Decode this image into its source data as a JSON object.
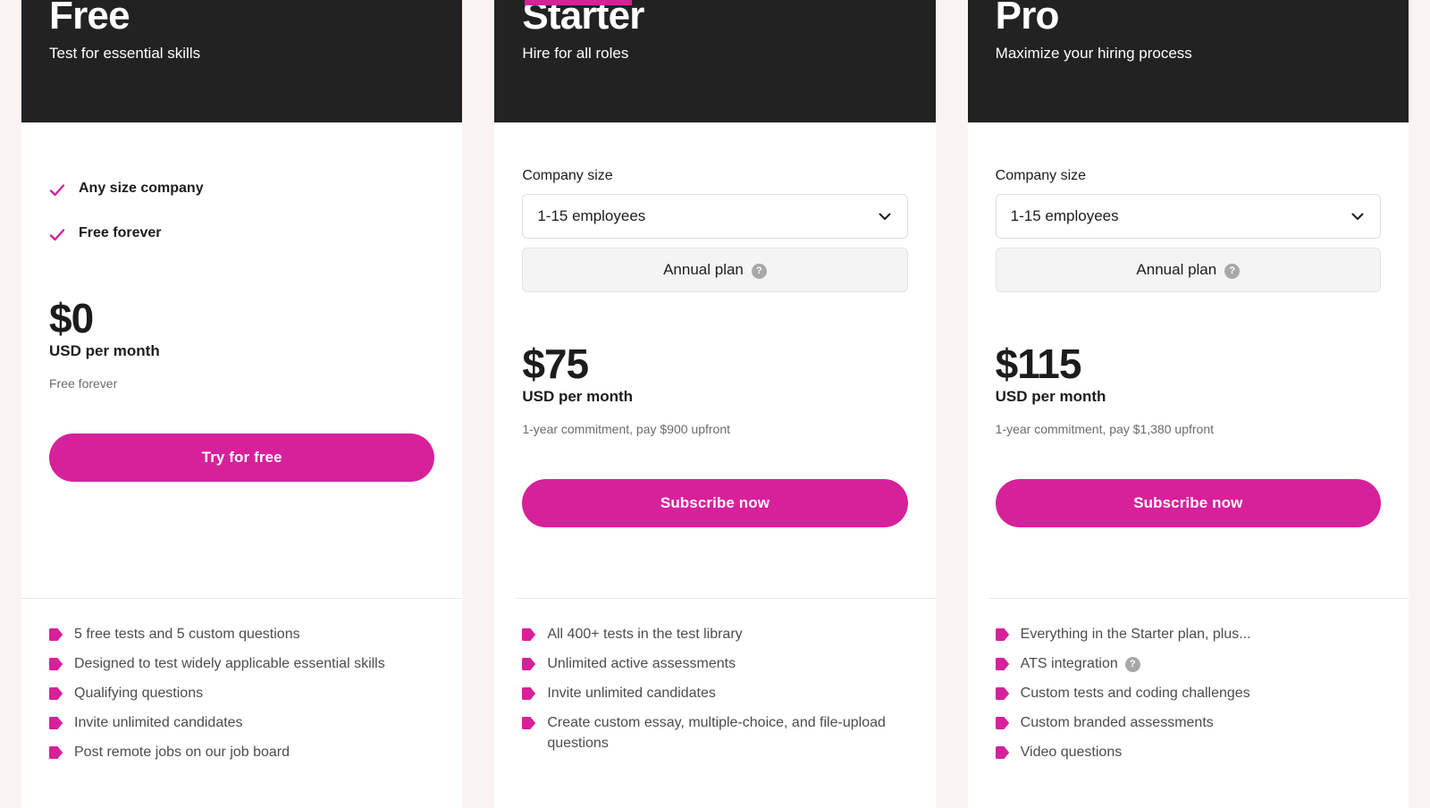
{
  "theme": {
    "page_background": "#F9F4F1",
    "card_background": "#FFFFFF",
    "header_background": "#222222",
    "accent": "#D6219B",
    "muted_text": "#6B6B6B"
  },
  "plans": [
    {
      "id": "free",
      "name": "Free",
      "tagline": "Test for essential skills",
      "highlighted": false,
      "checks": [
        {
          "icon": "check-icon",
          "label": "Any size company"
        },
        {
          "icon": "check-icon",
          "label": "Free forever"
        }
      ],
      "price": {
        "amount": "$0",
        "unit": "USD per month",
        "note": "Free forever"
      },
      "cta": {
        "label": "Try for free",
        "name": "try-for-free-button"
      },
      "features": [
        {
          "text": "5 free tests and 5 custom questions",
          "help": false
        },
        {
          "text": "Designed to test widely applicable essential skills",
          "help": false
        },
        {
          "text": "Qualifying questions",
          "help": false
        },
        {
          "text": "Invite unlimited candidates",
          "help": false
        },
        {
          "text": "Post remote jobs on our job board",
          "help": false
        }
      ]
    },
    {
      "id": "starter",
      "name": "Starter",
      "tagline": "Hire for all roles",
      "highlighted": true,
      "selector": {
        "label": "Company size",
        "value": "1-15 employees",
        "options": [
          "1-15 employees"
        ],
        "chevron_icon": "chevron-down-icon"
      },
      "term": {
        "label": "Annual plan",
        "help_glyph": "?",
        "help_icon": "help-circle-icon"
      },
      "price": {
        "amount": "$75",
        "unit": "USD per month",
        "note": "1-year commitment, pay $900 upfront"
      },
      "cta": {
        "label": "Subscribe now",
        "name": "subscribe-now-button"
      },
      "features": [
        {
          "text": "All 400+ tests in the test library",
          "help": false
        },
        {
          "text": "Unlimited active assessments",
          "help": false
        },
        {
          "text": "Invite unlimited candidates",
          "help": false
        },
        {
          "text": "Create custom essay, multiple-choice, and file-upload questions",
          "help": false
        }
      ]
    },
    {
      "id": "pro",
      "name": "Pro",
      "tagline": "Maximize your hiring process",
      "highlighted": false,
      "selector": {
        "label": "Company size",
        "value": "1-15 employees",
        "options": [
          "1-15 employees"
        ],
        "chevron_icon": "chevron-down-icon"
      },
      "term": {
        "label": "Annual plan",
        "help_glyph": "?",
        "help_icon": "help-circle-icon"
      },
      "price": {
        "amount": "$115",
        "unit": "USD per month",
        "note": "1-year commitment, pay $1,380 upfront"
      },
      "cta": {
        "label": "Subscribe now",
        "name": "subscribe-now-button"
      },
      "features": [
        {
          "text": "Everything in the Starter plan, plus...",
          "help": false
        },
        {
          "text": "ATS integration",
          "help": true,
          "help_glyph": "?"
        },
        {
          "text": "Custom tests and coding challenges",
          "help": false
        },
        {
          "text": "Custom branded assessments",
          "help": false
        },
        {
          "text": "Video questions",
          "help": false
        }
      ]
    }
  ]
}
